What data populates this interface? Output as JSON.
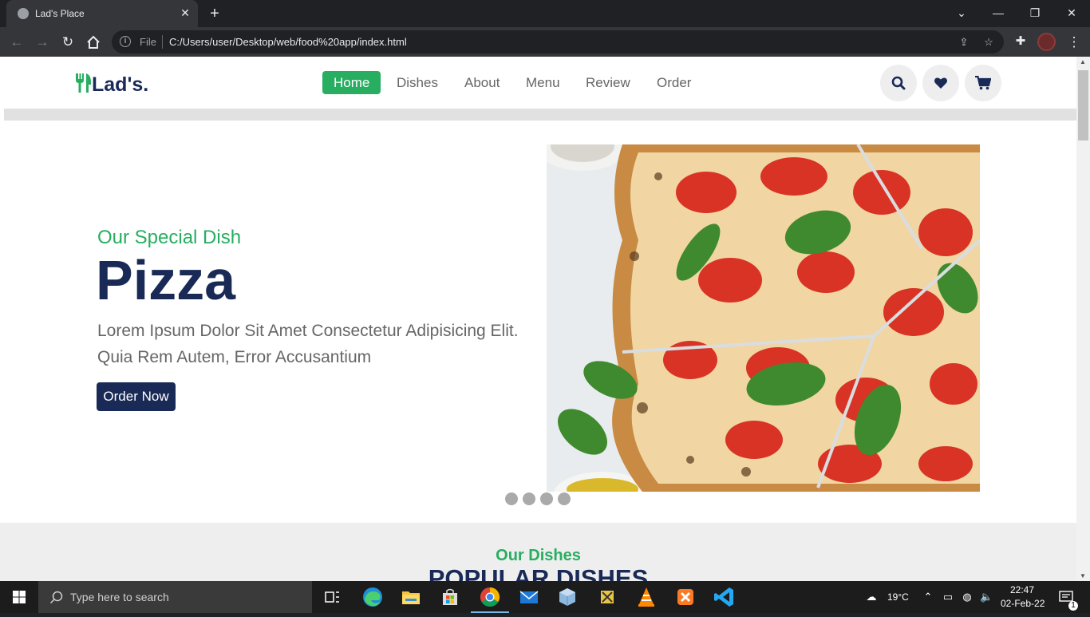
{
  "browser": {
    "tab_title": "Lad's Place",
    "tab_close": "✕",
    "new_tab": "+",
    "address_scheme": "File",
    "address_url": "C:/Users/user/Desktop/web/food%20app/index.html"
  },
  "site": {
    "logo_text": "Lad's.",
    "nav": [
      {
        "label": "Home"
      },
      {
        "label": "Dishes"
      },
      {
        "label": "About"
      },
      {
        "label": "Menu"
      },
      {
        "label": "Review"
      },
      {
        "label": "Order"
      }
    ],
    "active_nav": "Home",
    "accent_color": "#27ae60",
    "brand_color": "#192a56"
  },
  "hero": {
    "subtitle": "Our Special Dish",
    "title": "Pizza",
    "description": "Lorem Ipsum Dolor Sit Amet Consectetur Adipisicing Elit. Quia Rem Autem, Error Accusantium",
    "button": "Order Now",
    "slide_count": 4
  },
  "dishes": {
    "subtitle": "Our Dishes",
    "title": "popular dishes"
  },
  "taskbar": {
    "search_placeholder": "Type here to search",
    "temperature": "19°C",
    "time": "22:47",
    "date": "02-Feb-22",
    "notification_count": "1"
  }
}
